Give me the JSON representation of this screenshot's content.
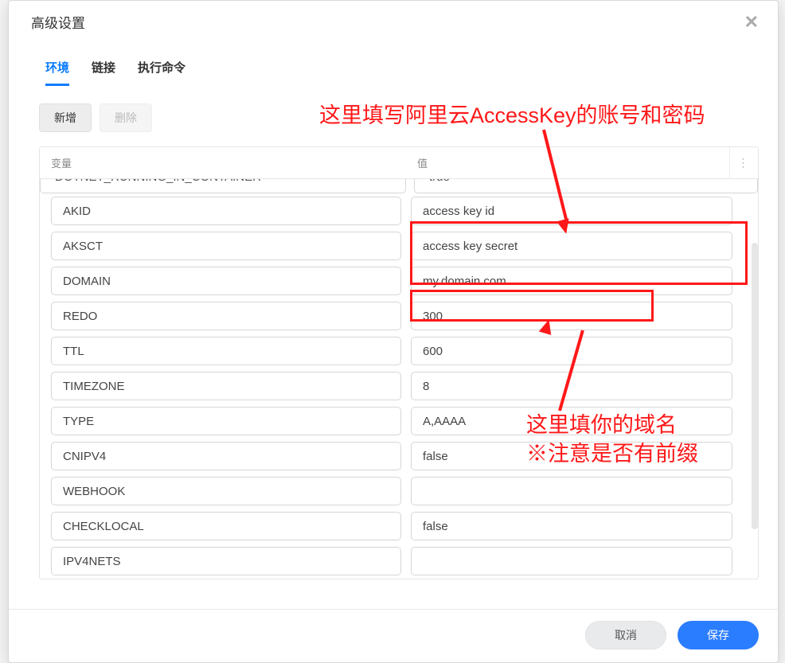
{
  "dialog": {
    "title": "高级设置"
  },
  "tabs": {
    "env": "环境",
    "links": "链接",
    "exec": "执行命令"
  },
  "actions": {
    "add": "新增",
    "delete": "删除"
  },
  "table": {
    "header_var": "变量",
    "header_val": "值",
    "cutoff_var": "DOTNET_RUNNING_IN_CONTAINER",
    "cutoff_val": "true",
    "rows": [
      {
        "var": "AKID",
        "val": "access key id"
      },
      {
        "var": "AKSCT",
        "val": "access key secret"
      },
      {
        "var": "DOMAIN",
        "val": "my.domain.com"
      },
      {
        "var": "REDO",
        "val": "300"
      },
      {
        "var": "TTL",
        "val": "600"
      },
      {
        "var": "TIMEZONE",
        "val": "8"
      },
      {
        "var": "TYPE",
        "val": "A,AAAA"
      },
      {
        "var": "CNIPV4",
        "val": "false"
      },
      {
        "var": "WEBHOOK",
        "val": ""
      },
      {
        "var": "CHECKLOCAL",
        "val": "false"
      },
      {
        "var": "IPV4NETS",
        "val": ""
      }
    ]
  },
  "annotations": {
    "top": "这里填写阿里云AccessKey的账号和密码",
    "bottom_line1": "这里填你的域名",
    "bottom_line2": "※注意是否有前缀"
  },
  "footer": {
    "cancel": "取消",
    "save": "保存"
  }
}
